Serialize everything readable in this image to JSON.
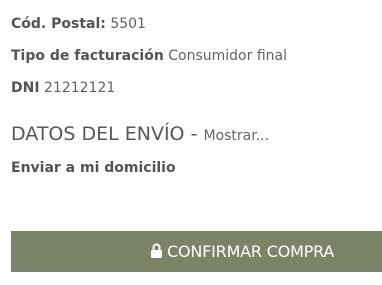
{
  "customer": {
    "postal_code_label": "Cód. Postal:",
    "postal_code_value": "5501",
    "billing_type_label": "Tipo de facturación",
    "billing_type_value": "Consumidor final",
    "dni_label": "DNI",
    "dni_value": "21212121"
  },
  "shipping": {
    "title": "DATOS DEL ENVÍO",
    "separator": "-",
    "toggle_label": "Mostrar...",
    "method": "Enviar a mi domicilio"
  },
  "confirm": {
    "label": "CONFIRMAR COMPRA",
    "icon": "lock-icon",
    "background_color": "#7c8467"
  }
}
